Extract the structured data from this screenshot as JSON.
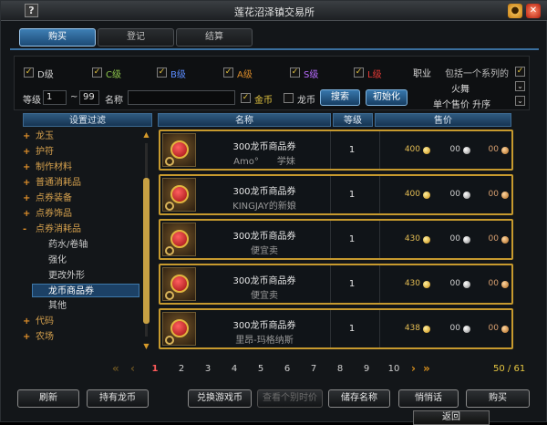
{
  "window": {
    "title": "莲花沼泽镇交易所"
  },
  "tabs": [
    {
      "label": "购买",
      "active": true
    },
    {
      "label": "登记",
      "active": false
    },
    {
      "label": "结算",
      "active": false
    }
  ],
  "filters": {
    "grades": [
      {
        "label": "D级",
        "checked": true,
        "color": "#e8e8e8"
      },
      {
        "label": "C级",
        "checked": true,
        "color": "#8bc34a"
      },
      {
        "label": "B级",
        "checked": true,
        "color": "#5b8cff"
      },
      {
        "label": "A级",
        "checked": true,
        "color": "#d88a2a"
      },
      {
        "label": "S级",
        "checked": true,
        "color": "#b86bff"
      },
      {
        "label": "L级",
        "checked": true,
        "color": "#e53935"
      }
    ],
    "level_label": "等级",
    "level_min": "1",
    "level_sep": "~",
    "level_max": "99",
    "name_label": "名称",
    "name_value": "",
    "gold_label": "金币",
    "gold_checked": true,
    "dragon_label": "龙币",
    "dragon_checked": false,
    "search_label": "搜索",
    "reset_label": "初始化",
    "job_label": "职业",
    "include_series_label": "包括一个系列的",
    "job_value": "火舞",
    "sort_value": "单个售价 升序"
  },
  "headers": {
    "filter": "设置过滤",
    "name": "名称",
    "level": "等级",
    "price": "售价"
  },
  "tree": [
    {
      "label": "龙玉",
      "type": "cat"
    },
    {
      "label": "护符",
      "type": "cat"
    },
    {
      "label": "制作材料",
      "type": "cat"
    },
    {
      "label": "普通消耗品",
      "type": "cat"
    },
    {
      "label": "点券装备",
      "type": "cat"
    },
    {
      "label": "点券饰品",
      "type": "cat"
    },
    {
      "label": "点券消耗品",
      "type": "open"
    },
    {
      "label": "药水/卷轴",
      "type": "sub"
    },
    {
      "label": "强化",
      "type": "sub"
    },
    {
      "label": "更改外形",
      "type": "sub"
    },
    {
      "label": "龙币商品券",
      "type": "sel"
    },
    {
      "label": "其他",
      "type": "sub"
    },
    {
      "label": "代码",
      "type": "cat"
    },
    {
      "label": "农场",
      "type": "cat"
    }
  ],
  "rows": [
    {
      "item": "300龙币商品券",
      "seller": "Amo°　　学妹",
      "level": "1",
      "gold": "400",
      "silver": "00",
      "copper": "00"
    },
    {
      "item": "300龙币商品券",
      "seller": "KINGJAY的新娘",
      "level": "1",
      "gold": "400",
      "silver": "00",
      "copper": "00"
    },
    {
      "item": "300龙币商品券",
      "seller": "便宜卖",
      "level": "1",
      "gold": "430",
      "silver": "00",
      "copper": "00"
    },
    {
      "item": "300龙币商品券",
      "seller": "便宜卖",
      "level": "1",
      "gold": "430",
      "silver": "00",
      "copper": "00"
    },
    {
      "item": "300龙币商品券",
      "seller": "里昂-玛格纳斯",
      "level": "1",
      "gold": "438",
      "silver": "00",
      "copper": "00"
    }
  ],
  "pagination": {
    "pages": [
      "1",
      "2",
      "3",
      "4",
      "5",
      "6",
      "7",
      "8",
      "9",
      "10"
    ],
    "current": "1",
    "count": "50 / 61"
  },
  "buttons": {
    "refresh": "刷新",
    "own_dragon": "持有龙币",
    "exchange": "兑换游戏币",
    "view_price": "查看个别时价",
    "save_name": "储存名称",
    "whisper": "悄悄话",
    "buy": "购买",
    "back": "返回"
  }
}
